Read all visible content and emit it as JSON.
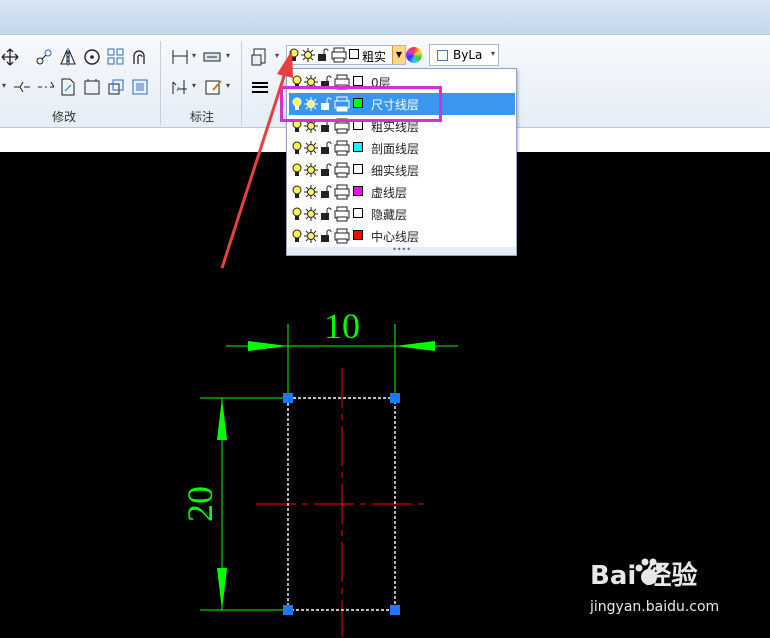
{
  "ribbon": {
    "panel_modify_label": "修改",
    "panel_dimension_label": "标注",
    "layer_combo": {
      "current_layer": "粗实",
      "swatch_color": "#ffffff"
    },
    "linetype_combo": {
      "value": "ByLa",
      "swatch_color": "#ffffff"
    },
    "icons": [
      "move-icon",
      "copy-icon",
      "mirror-icon",
      "rotate-icon",
      "array-icon",
      "offset-icon",
      "trim-icon",
      "extend-icon",
      "stretch-icon",
      "scale-icon",
      "break-icon",
      "explode-icon",
      "linear-dimension-icon",
      "dimension-style-icon",
      "baseline-dimension-icon",
      "text-edit-icon",
      "layer-properties-icon",
      "lineweight-icon"
    ]
  },
  "layer_dropdown": {
    "layers": [
      {
        "name": "0层",
        "color": "#ffffff",
        "selected": false
      },
      {
        "name": "尺寸线层",
        "color": "#00ff00",
        "selected": true
      },
      {
        "name": "粗实线层",
        "color": "#ffffff",
        "selected": false
      },
      {
        "name": "剖面线层",
        "color": "#00ffff",
        "selected": false
      },
      {
        "name": "细实线层",
        "color": "#ffffff",
        "selected": false
      },
      {
        "name": "虚线层",
        "color": "#ff00ff",
        "selected": false
      },
      {
        "name": "隐藏层",
        "color": "#ffffff",
        "selected": false
      },
      {
        "name": "中心线层",
        "color": "#ff0000",
        "selected": false
      }
    ],
    "highlight_color": "#d331d3",
    "selection_color": "#3a97f0"
  },
  "drawing": {
    "dimension_width": "10",
    "dimension_height": "20",
    "dimension_color": "#00ff00",
    "centerline_color": "#ff0000",
    "grip_color": "#1e78ff",
    "arrow_annotation_color": "#e84040"
  },
  "watermark": {
    "brand": "Bai  经验",
    "url": "jingyan.baidu.com"
  }
}
